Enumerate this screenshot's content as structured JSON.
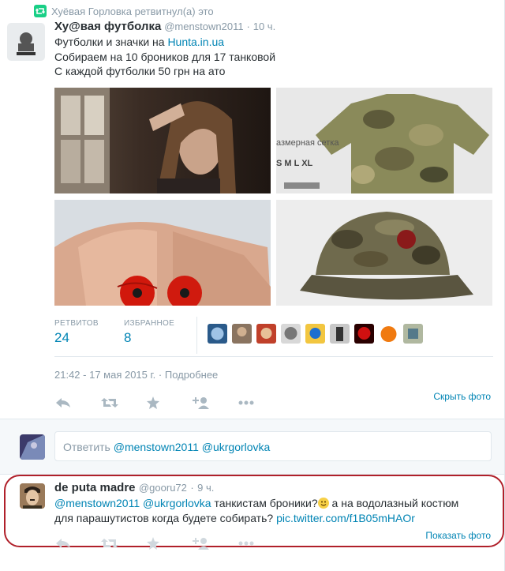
{
  "retweet": {
    "text": "Хуёвая Горловка ретвитнул(а) это"
  },
  "tweet": {
    "fullname": "Ху@вая футболка",
    "handle": "@menstown2011",
    "dot": "·",
    "time": "10 ч.",
    "line1_prefix": "Футболки и значки на ",
    "line1_link": "Hunta.in.ua",
    "line2": "Собираем на 10 броников для 17 танковой",
    "line3": "С каждой футболки 50 грн на ато",
    "photos": [
      {
        "name": "photo-girl"
      },
      {
        "name": "photo-camo-shirt",
        "caption1": "азмерная сетка",
        "caption2": "S M L XL"
      },
      {
        "name": "photo-poppy-pins"
      },
      {
        "name": "photo-camo-cap"
      }
    ],
    "stats": {
      "retweets_label": "РЕТВИТОВ",
      "retweets_value": "24",
      "favorites_label": "ИЗБРАННОЕ",
      "favorites_value": "8"
    },
    "date": "21:42 - 17 мая 2015 г.",
    "details_link": "Подробнее",
    "hide_photo": "Скрыть фото"
  },
  "reply_box": {
    "placeholder_prefix": "Ответить",
    "mentions": "@menstown2011 @ukrgorlovka"
  },
  "reply": {
    "fullname": "de puta madre",
    "handle": "@gooru72",
    "dot": "·",
    "time": "9 ч.",
    "mentions": "@menstown2011 @ukrgorlovka",
    "text1": " танкистам броники?",
    "text2": " а на водолазный костюм",
    "text3": "для парашутистов когда будете собирать?",
    "link": "pic.twitter.com/f1B05mHAOr",
    "show_photo": "Показать фото"
  },
  "colors": {
    "link": "#0084b4",
    "muted": "#8899a6",
    "retweet_green": "#19cf86",
    "highlight": "#b0202a"
  }
}
